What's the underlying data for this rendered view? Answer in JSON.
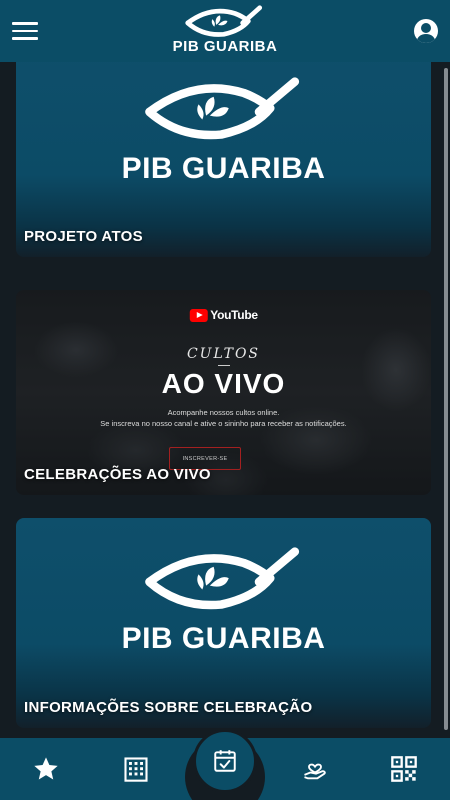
{
  "header": {
    "logo_text": "PIB GUARIBA",
    "menu_icon": "hamburger-menu-icon",
    "profile_icon": "account-circle-icon",
    "background_color": "#0b4d66"
  },
  "cards": [
    {
      "title": "PROJETO ATOS",
      "logo_text": "PIB GUARIBA"
    },
    {
      "title": "CELEBRAÇÕES AO VIVO",
      "youtube_label": "YouTube",
      "cultos_label": "CULTOS",
      "headline": "AO VIVO",
      "sub_line_1": "Acompanhe nossos cultos online.",
      "sub_line_2": "Se inscreva no nosso canal e ative o sininho para receber as notificações.",
      "button_label": "INSCREVER-SE"
    },
    {
      "title": "INFORMAÇÕES SOBRE CELEBRAÇÃO",
      "logo_text": "PIB GUARIBA"
    }
  ],
  "bottom_nav": {
    "items": [
      {
        "icon": "star-icon"
      },
      {
        "icon": "building-icon"
      },
      {
        "icon": "calendar-check-icon"
      },
      {
        "icon": "heart-hand-icon"
      },
      {
        "icon": "qr-code-icon"
      }
    ],
    "background_color": "#0b4d66"
  }
}
